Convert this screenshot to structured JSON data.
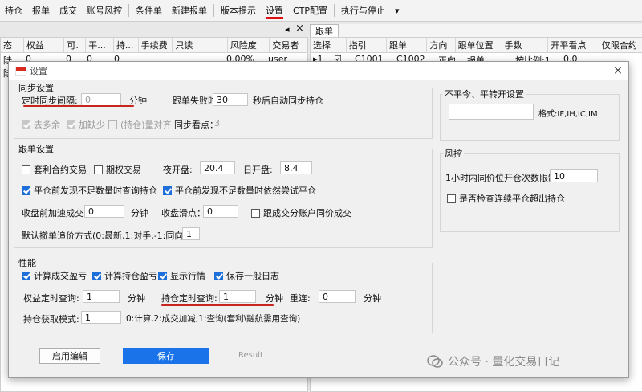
{
  "menubar": {
    "items": [
      {
        "label": "持仓"
      },
      {
        "label": "报单"
      },
      {
        "label": "成交"
      },
      {
        "label": "账号风控"
      },
      {
        "label": "条件单"
      },
      {
        "label": "新建报单"
      },
      {
        "label": "版本提示"
      },
      {
        "label": "设置"
      },
      {
        "label": "CTP配置"
      },
      {
        "label": "执行与停止"
      }
    ],
    "dropdown_glyph": "▾"
  },
  "left_panel": {
    "columns": [
      "态",
      "权益",
      "可.",
      "平...",
      "持...",
      "手续费",
      "只读",
      "风险度",
      "交易者"
    ],
    "row1": [
      "陆",
      "0",
      "0",
      "0",
      "0",
      "",
      "",
      "0.00%",
      "user"
    ],
    "row2_first": "陆",
    "close_glyph": "×",
    "arrow_glyph": "◂"
  },
  "right_panel": {
    "tab": "跟单",
    "columns": [
      "选择",
      "指引",
      "跟单",
      "方向",
      "跟单位置",
      "手数",
      "开平看点",
      "仅限合约"
    ],
    "row1": [
      "▸1",
      "☑",
      "C1001",
      "C1002",
      "正向",
      "报单",
      "按比例:1",
      "0.0",
      ""
    ]
  },
  "dialog": {
    "title": "设置",
    "close_glyph": "×",
    "sync": {
      "label": "同步设置",
      "interval_label": "定时同步间隔:",
      "interval_value": "0",
      "interval_unit": "分钟",
      "fail_label": "跟单失败时",
      "fail_value": "30",
      "fail_suffix": "秒后自动同步持仓",
      "cb_extra": "去多余",
      "cb_add": "加缺少",
      "cb_align": "(持仓)量对齐",
      "sync_point_label": "同步看点：",
      "sync_point_value": "3"
    },
    "close_trans": {
      "label": "不平今、平转开设置",
      "format": "格式:IF,IH,IC,IM",
      "value": ""
    },
    "follow": {
      "label": "跟单设置",
      "cb_arb": "套利合约交易",
      "cb_option": "期权交易",
      "night_label": "夜开盘:",
      "night_value": "20.4",
      "day_label": "日开盘:",
      "day_value": "8.4",
      "cb_query_pos": "平仓前发现不足数量时查询持仓",
      "cb_try_close": "平仓前发现不足数量时依然尝试平仓",
      "accel_label": "收盘前加速成交:",
      "accel_value": "0",
      "accel_unit": "分钟",
      "slip_label": "收盘滑点：",
      "slip_value": "0",
      "cb_same_price": "跟成交分账户同价成交",
      "chase_label": "默认撤单追价方式(0:最新,1:对手,-1:同向):",
      "chase_value": "1"
    },
    "risk": {
      "label": "风控",
      "limit_label": "1小时内同价位开仓次数限制",
      "limit_value": "10",
      "cb_consecutive": "是否检查连续平仓超出持仓"
    },
    "perf": {
      "label": "性能",
      "cb_trade_pnl": "计算成交盈亏",
      "cb_pos_pnl": "计算持仓盈亏",
      "cb_show_quote": "显示行情",
      "cb_save_log": "保存一般日志",
      "equity_label": "权益定时查询:",
      "equity_value": "1",
      "equity_unit": "分钟",
      "pos_label": "持仓定时查询:",
      "pos_value": "1",
      "pos_unit": "分钟",
      "reconnect_label": "重连:",
      "reconnect_value": "0",
      "reconnect_unit": "分钟",
      "mode_label": "持仓获取模式:",
      "mode_value": "1",
      "mode_desc": "0:计算,2:成交加减;1:查询(套利\\融航需用查询)"
    },
    "buttons": {
      "enable_edit": "启用编辑",
      "save": "保存",
      "result": "Result"
    }
  },
  "watermark": "公众号 · 量化交易日记",
  "colors": {
    "accent": "#1a73e8",
    "annotation": "#c7261e"
  }
}
